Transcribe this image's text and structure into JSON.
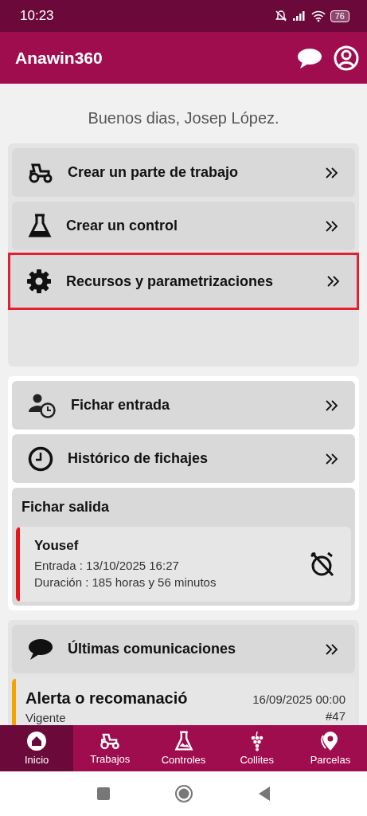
{
  "status_bar": {
    "time": "10:23",
    "battery": "76"
  },
  "app_bar": {
    "title": "Anawin360"
  },
  "greeting": "Buenos dias, Josep López.",
  "main_menu": [
    {
      "kind": "tractor",
      "label": "Crear un parte de trabajo",
      "highlighted": false
    },
    {
      "kind": "flask",
      "label": "Crear un control",
      "highlighted": false
    },
    {
      "kind": "gear",
      "label": "Recursos y parametrizaciones",
      "highlighted": true
    }
  ],
  "time_menu": [
    {
      "kind": "person-clock",
      "label": "Fichar entrada"
    },
    {
      "kind": "clock",
      "label": "Histórico de fichajes"
    }
  ],
  "clock_out": {
    "title": "Fichar salida",
    "entries": [
      {
        "name": "Yousef",
        "entry": "Entrada : 13/10/2025 16:27",
        "duration": "Duración : 185 horas y 56 minutos",
        "color": "#e8141c"
      }
    ]
  },
  "communications": {
    "title": "Últimas comunicaciones",
    "items": [
      {
        "title": "Alerta o recomanació",
        "status": "Vigente",
        "date": "16/09/2025 00:00",
        "number": "#47",
        "color": "#f5a300"
      }
    ]
  },
  "bottom_nav": [
    {
      "kind": "home",
      "label": "Inicio",
      "selected": true
    },
    {
      "kind": "tractor",
      "label": "Trabajos",
      "selected": false
    },
    {
      "kind": "flask",
      "label": "Controles",
      "selected": false
    },
    {
      "kind": "grape",
      "label": "Collites",
      "selected": false
    },
    {
      "kind": "pin",
      "label": "Parcelas",
      "selected": false
    }
  ]
}
